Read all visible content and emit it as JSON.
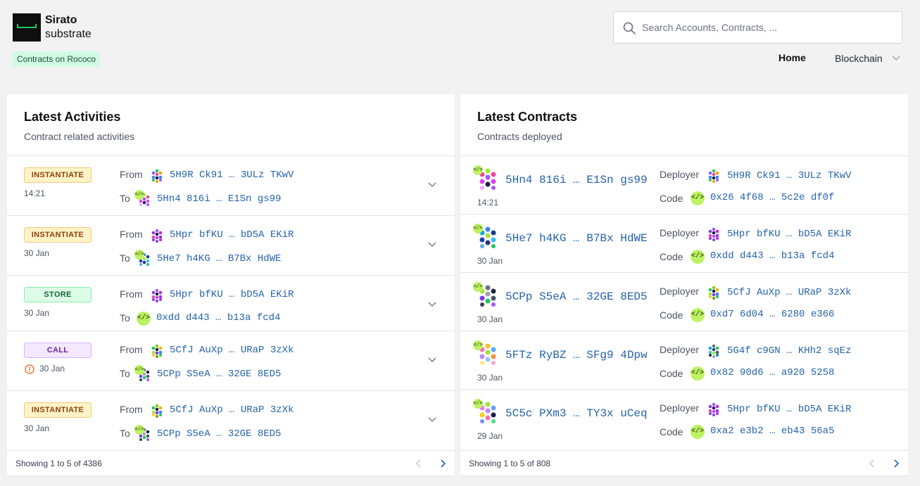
{
  "brand": {
    "name": "Sirato",
    "sub": "substrate",
    "network": "Contracts on Rococo"
  },
  "search": {
    "placeholder": "Search Accounts, Contracts, ..."
  },
  "nav": {
    "home": "Home",
    "blockchain": "Blockchain"
  },
  "activities": {
    "title": "Latest Activities",
    "subtitle": "Contract related activities",
    "from_label": "From",
    "to_label": "To",
    "rows": [
      {
        "type": "INSTANTIATE",
        "when": "14:21",
        "from": "5H9R Ck91 … 3ULz TKwV",
        "to": "5Hn4 816i … E1Sn gs99"
      },
      {
        "type": "INSTANTIATE",
        "when": "30 Jan",
        "from": "5Hpr bfKU … bD5A EKiR",
        "to": "5He7 h4KG … B7Bx HdWE"
      },
      {
        "type": "STORE",
        "when": "30 Jan",
        "from": "5Hpr bfKU … bD5A EKiR",
        "to": "0xdd d443 … b13a fcd4"
      },
      {
        "type": "CALL",
        "when": "30 Jan",
        "from": "5CfJ AuXp … URaP 3zXk",
        "to": "5CPp S5eA … 32GE 8ED5"
      },
      {
        "type": "INSTANTIATE",
        "when": "30 Jan",
        "from": "5CfJ AuXp … URaP 3zXk",
        "to": "5CPp S5eA … 32GE 8ED5"
      }
    ],
    "footer": "Showing 1 to 5 of 4386"
  },
  "contracts": {
    "title": "Latest Contracts",
    "subtitle": "Contracts deployed",
    "deployer_label": "Deployer",
    "code_label": "Code",
    "rows": [
      {
        "address": "5Hn4 816i … E1Sn gs99",
        "when": "14:21",
        "deployer": "5H9R Ck91 … 3ULz TKwV",
        "code": "0x26 4f68 … 5c2e df0f"
      },
      {
        "address": "5He7 h4KG … B7Bx HdWE",
        "when": "30 Jan",
        "deployer": "5Hpr bfKU … bD5A EKiR",
        "code": "0xdd d443 … b13a fcd4"
      },
      {
        "address": "5CPp S5eA … 32GE 8ED5",
        "when": "30 Jan",
        "deployer": "5CfJ AuXp … URaP 3zXk",
        "code": "0xd7 6d04 … 6280 e366"
      },
      {
        "address": "5FTz RyBZ … SFg9 4Dpw",
        "when": "30 Jan",
        "deployer": "5G4f c9GN … KHh2 sqEz",
        "code": "0x82 90d6 … a920 5258"
      },
      {
        "address": "5C5c PXm3 … TY3x uCeq",
        "when": "29 Jan",
        "deployer": "5Hpr bfKU … bD5A EKiR",
        "code": "0xa2 e3b2 … eb43 56a5"
      }
    ],
    "footer": "Showing 1 to 5 of 808"
  },
  "icons": {
    "code": "</>"
  }
}
